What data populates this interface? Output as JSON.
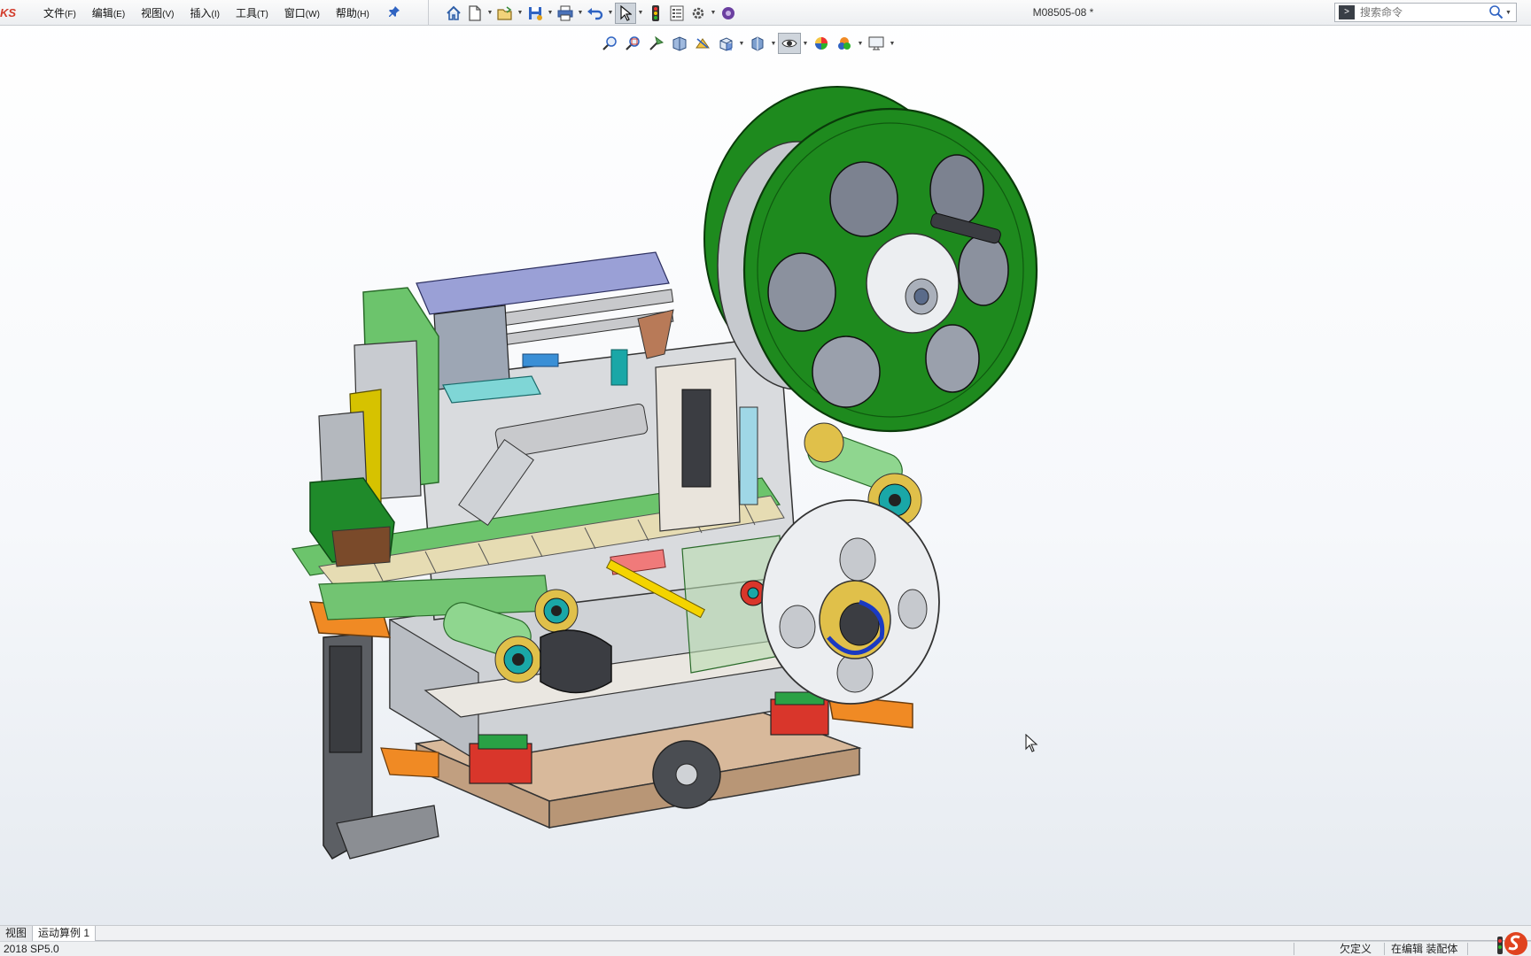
{
  "app": {
    "brand_fragment": "KS",
    "document_title": "M08505-08 *"
  },
  "menu": [
    {
      "label": "文件",
      "key": "(F)"
    },
    {
      "label": "编辑",
      "key": "(E)"
    },
    {
      "label": "视图",
      "key": "(V)"
    },
    {
      "label": "插入",
      "key": "(I)"
    },
    {
      "label": "工具",
      "key": "(T)"
    },
    {
      "label": "窗口",
      "key": "(W)"
    },
    {
      "label": "帮助",
      "key": "(H)"
    }
  ],
  "search": {
    "placeholder": "搜索命令"
  },
  "bottom_tabs": [
    {
      "label": "视图"
    },
    {
      "label": "运动算例 1"
    }
  ],
  "status": {
    "version": "2018 SP5.0",
    "definition": "欠定义",
    "editing": "在编辑 装配体"
  },
  "icons": {
    "main_toolbar": [
      "home-icon",
      "new-document-icon",
      "open-icon",
      "save-icon",
      "print-icon",
      "undo-icon",
      "select-icon",
      "rebuild-icon",
      "file-properties-icon",
      "options-icon",
      "add-in-icon"
    ],
    "view_toolbar": [
      "zoom-to-fit-icon",
      "zoom-area-icon",
      "previous-view-icon",
      "section-view-icon",
      "dynamic-annotation-icon",
      "view-orientation-icon",
      "display-style-icon",
      "hide-show-icon",
      "appearance-icon",
      "scene-icon",
      "view-settings-icon"
    ]
  },
  "colors": {
    "reel_green": "#1e8a1e",
    "accent_orange": "#f08a24",
    "teal": "#1aa7a7",
    "brand_red": "#d23a2a"
  }
}
